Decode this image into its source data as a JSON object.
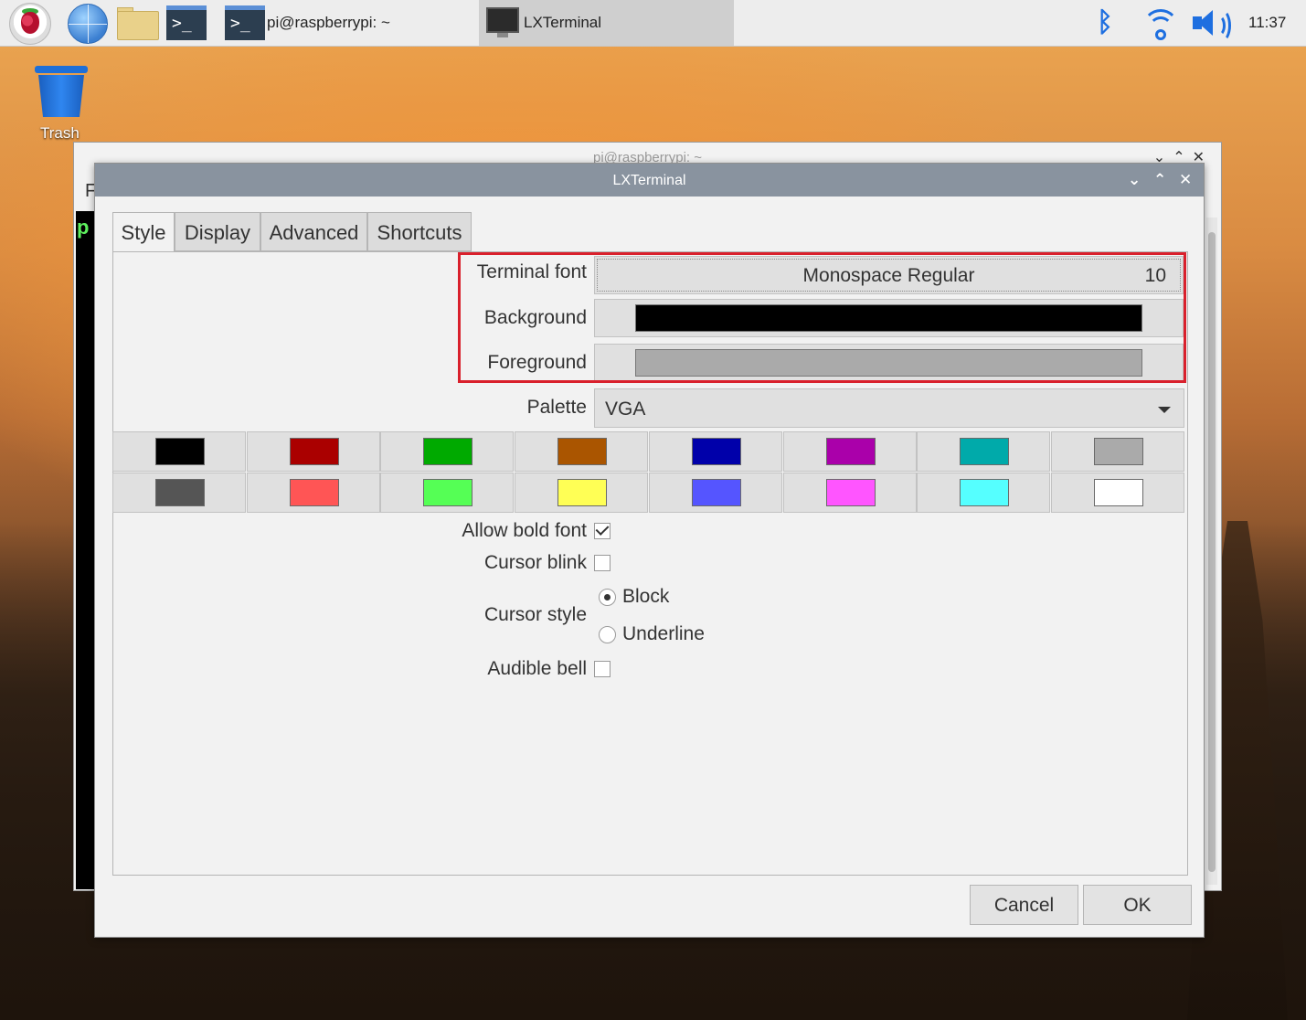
{
  "taskbar": {
    "task_terminal_label": "pi@raspberrypi: ~",
    "task_active_label": "LXTerminal",
    "clock": "11:37",
    "icons": [
      "raspberry-menu-icon",
      "web-browser-icon",
      "file-manager-icon",
      "terminal-icon",
      "bluetooth-icon",
      "wifi-icon",
      "volume-icon"
    ]
  },
  "desktop": {
    "trash_label": "Trash"
  },
  "back_window": {
    "title": "pi@raspberrypi: ~",
    "menu_letter": "F",
    "prompt_char": "p"
  },
  "dialog": {
    "title": "LXTerminal",
    "tabs": [
      {
        "label": "Style",
        "active": true
      },
      {
        "label": "Display",
        "active": false
      },
      {
        "label": "Advanced",
        "active": false
      },
      {
        "label": "Shortcuts",
        "active": false
      }
    ],
    "style": {
      "terminal_font_label": "Terminal font",
      "font_name": "Monospace Regular",
      "font_size": "10",
      "background_label": "Background",
      "background_color": "#000000",
      "foreground_label": "Foreground",
      "foreground_color": "#aaaaaa",
      "palette_label": "Palette",
      "palette_value": "VGA",
      "palette_colors": [
        "#000000",
        "#aa0000",
        "#00aa00",
        "#aa5500",
        "#0000aa",
        "#aa00aa",
        "#00aaaa",
        "#aaaaaa",
        "#555555",
        "#ff5555",
        "#55ff55",
        "#ffff55",
        "#5555ff",
        "#ff55ff",
        "#55ffff",
        "#ffffff"
      ],
      "allow_bold_label": "Allow bold font",
      "allow_bold_checked": true,
      "cursor_blink_label": "Cursor blink",
      "cursor_blink_checked": false,
      "cursor_style_label": "Cursor style",
      "cursor_block_label": "Block",
      "cursor_underline_label": "Underline",
      "cursor_style_selected": "Block",
      "audible_bell_label": "Audible bell",
      "audible_bell_checked": false
    },
    "buttons": {
      "cancel": "Cancel",
      "ok": "OK"
    },
    "highlight_color": "#d9202c"
  }
}
